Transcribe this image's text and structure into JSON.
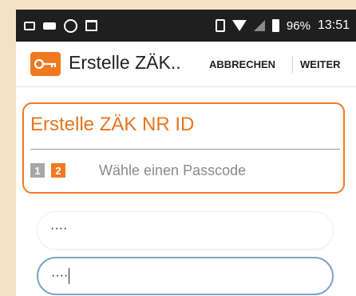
{
  "status_bar": {
    "icons_left": [
      "image-icon",
      "keyboard-icon",
      "app-icon",
      "shopping-bag-icon"
    ],
    "icons_right": [
      "vibrate-icon",
      "wifi-icon",
      "signal-icon",
      "battery-icon"
    ],
    "battery": "96%",
    "time": "13:51"
  },
  "app_bar": {
    "title": "Erstelle ZÄK..",
    "cancel_label": "ABBRECHEN",
    "next_label": "WEITER",
    "accent_color": "#f07a22"
  },
  "card": {
    "title": "Erstelle ZÄK NR ID",
    "steps": [
      "1",
      "2"
    ],
    "active_step": "2",
    "step_label": "Wähle einen Passcode"
  },
  "fields": {
    "passcode_value": "····",
    "confirm_value": "····"
  }
}
